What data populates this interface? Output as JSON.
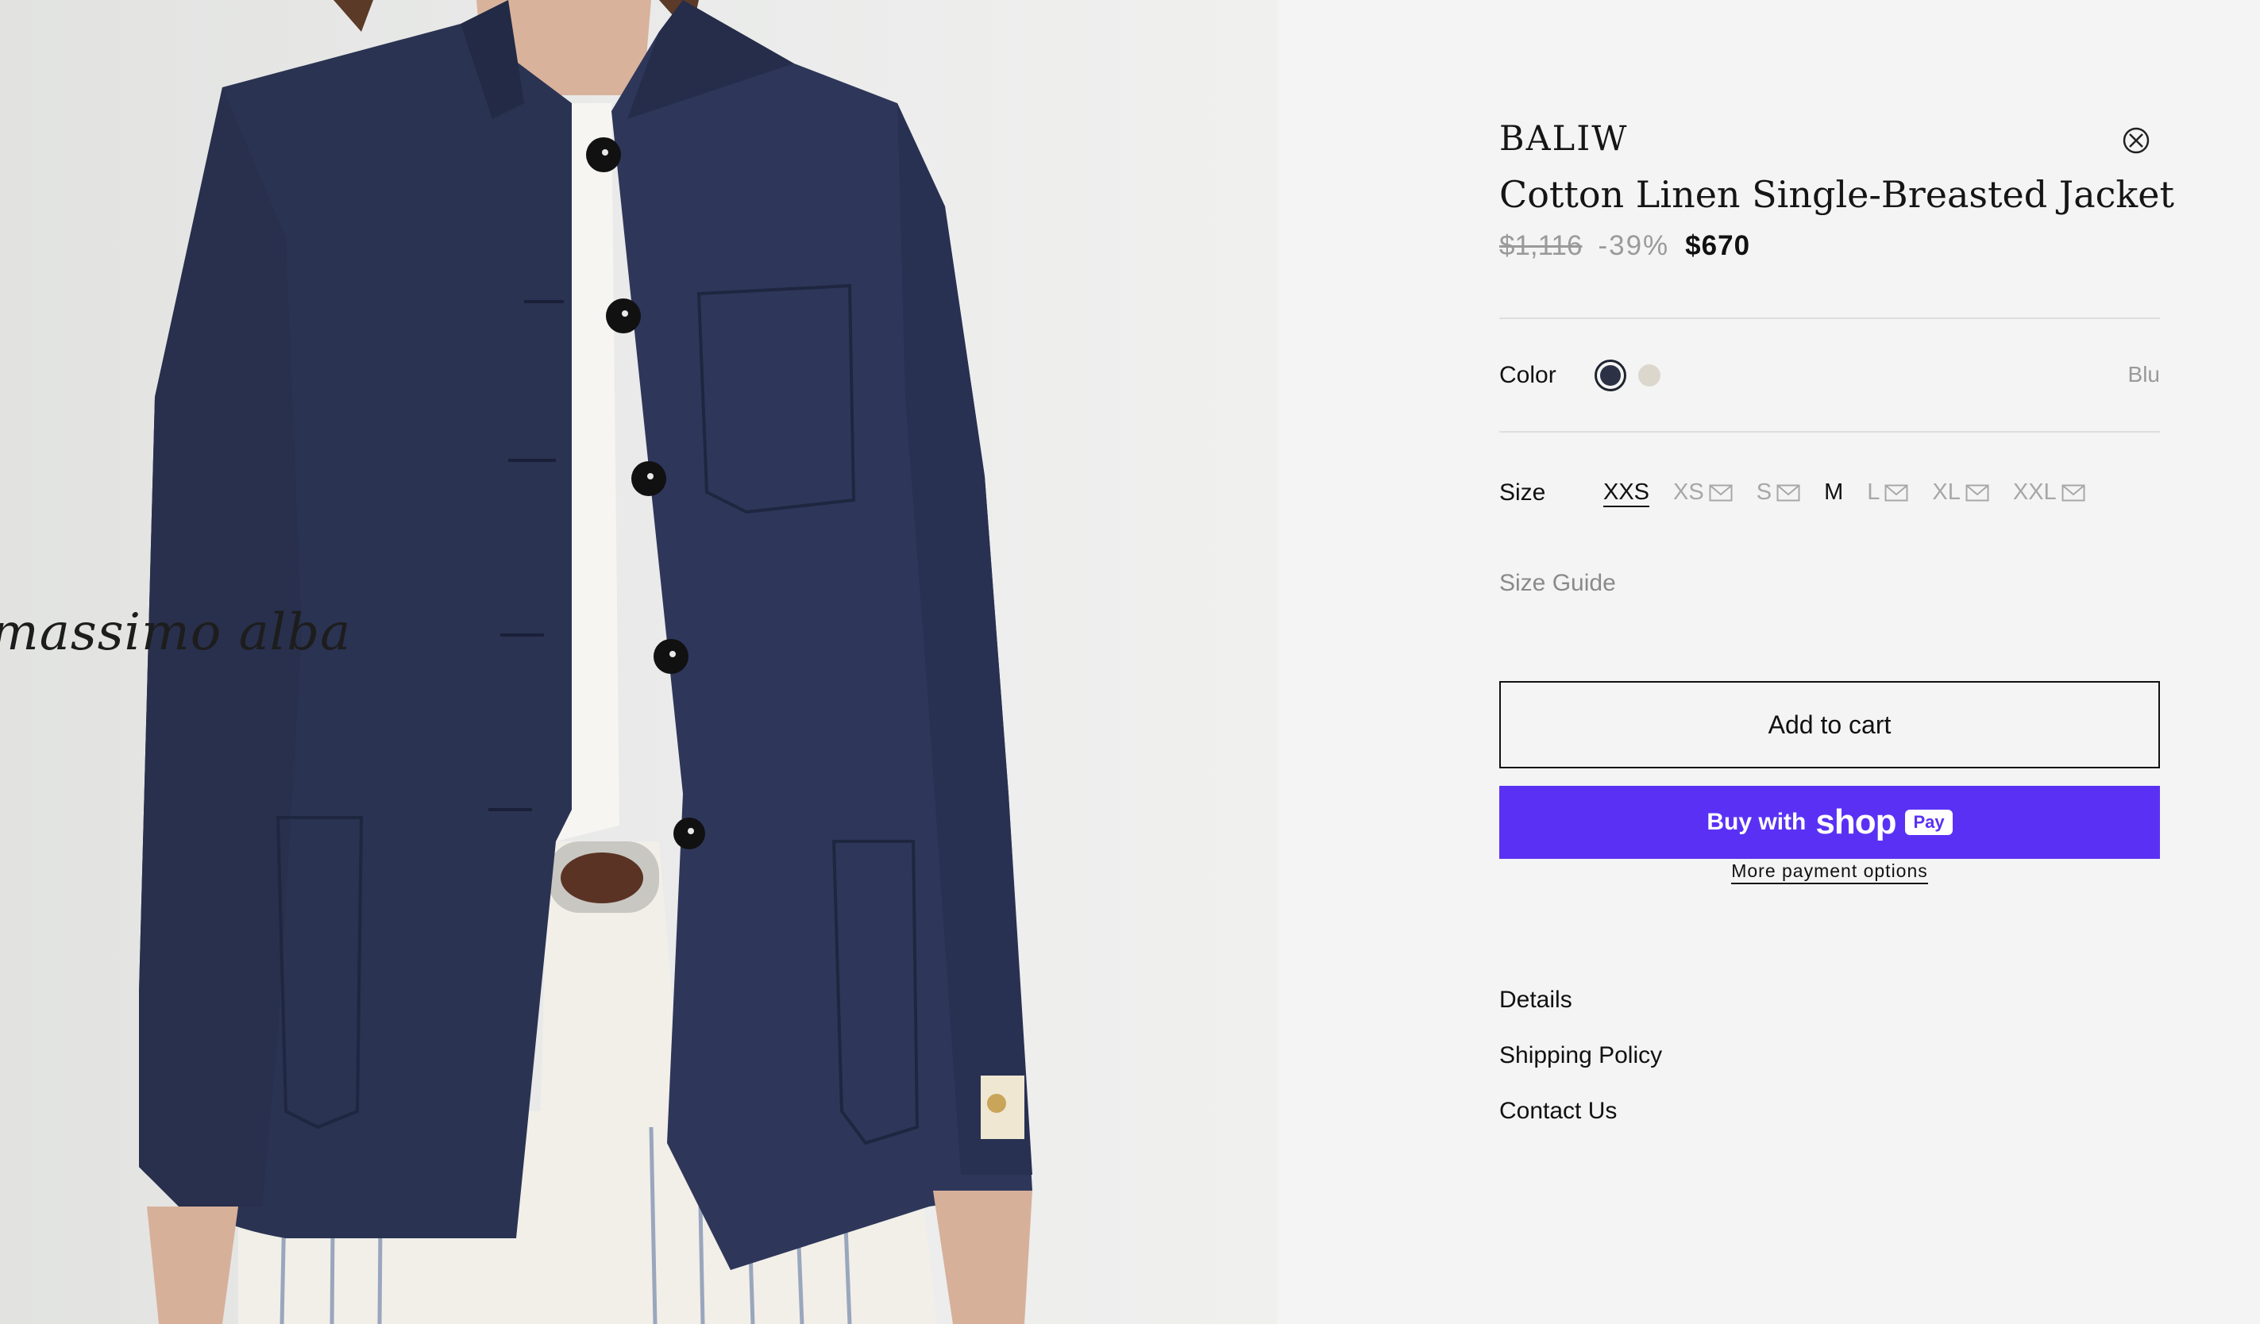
{
  "hero": {
    "watermark_text": "massimo alba"
  },
  "product": {
    "vendor": "BALIW",
    "title": "Cotton Linen Single-Breasted Jacket",
    "price_compare": "$1,116",
    "discount": "-39%",
    "price": "$670",
    "close_icon": "close-circle-icon"
  },
  "options": {
    "color_label": "Color",
    "color_value": "Blu",
    "swatches": [
      {
        "name": "navy",
        "color": "#2c3145",
        "selected": true
      },
      {
        "name": "ecru",
        "color": "#dcd7cd",
        "selected": false
      }
    ],
    "size_label": "Size",
    "sizes": [
      {
        "label": "XXS",
        "state": "selected"
      },
      {
        "label": "XS",
        "state": "sold-out"
      },
      {
        "label": "S",
        "state": "sold-out"
      },
      {
        "label": "M",
        "state": "available"
      },
      {
        "label": "L",
        "state": "sold-out"
      },
      {
        "label": "XL",
        "state": "sold-out"
      },
      {
        "label": "XXL",
        "state": "sold-out"
      }
    ],
    "size_guide": "Size Guide"
  },
  "actions": {
    "add_to_cart": "Add to cart",
    "buy_with": "Buy with",
    "shop_word": "shop",
    "pay_badge": "Pay",
    "more_payment_options": "More payment options"
  },
  "accordion": {
    "details": "Details",
    "shipping": "Shipping Policy",
    "contact": "Contact Us"
  },
  "colors": {
    "shop_pay": "#5a31f4",
    "background": "#f4f4f4"
  }
}
